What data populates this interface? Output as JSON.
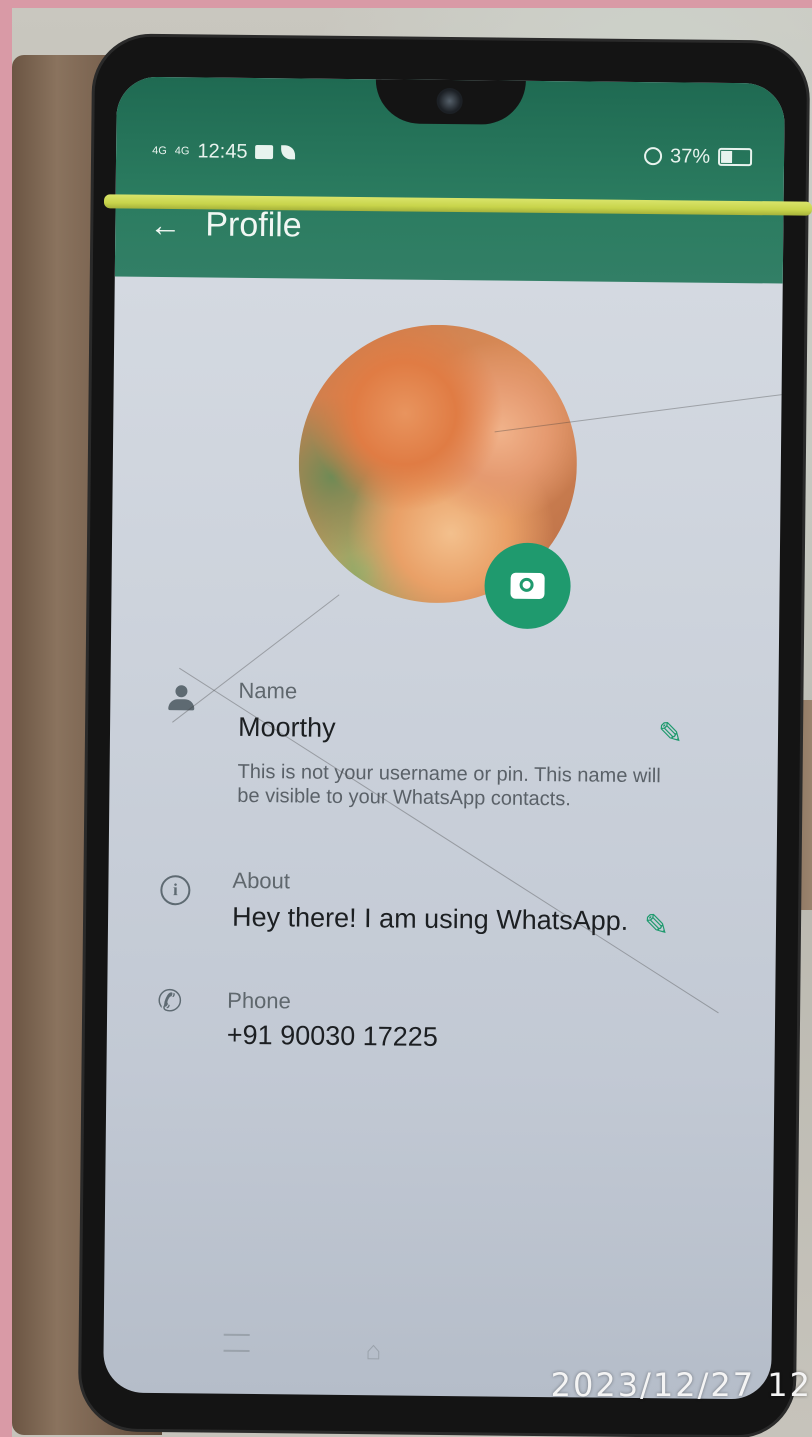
{
  "status_bar": {
    "signal1": "4G",
    "signal2": "4G",
    "time": "12:45",
    "battery_percent": "37%"
  },
  "app_bar": {
    "title": "Profile"
  },
  "profile": {
    "name_label": "Name",
    "name_value": "Moorthy",
    "name_helper": "This is not your username or pin. This name will be visible to your WhatsApp contacts.",
    "about_label": "About",
    "about_value": "Hey there! I am using WhatsApp.",
    "phone_label": "Phone",
    "phone_value": "+91 90030 17225"
  },
  "photo_timestamp": "2023/12/27  12",
  "colors": {
    "accent": "#1f9a6e",
    "app_bar": "#2b7c60"
  },
  "icons": [
    "back-arrow-icon",
    "camera-icon",
    "person-icon",
    "info-icon",
    "phone-icon",
    "edit-icon"
  ]
}
